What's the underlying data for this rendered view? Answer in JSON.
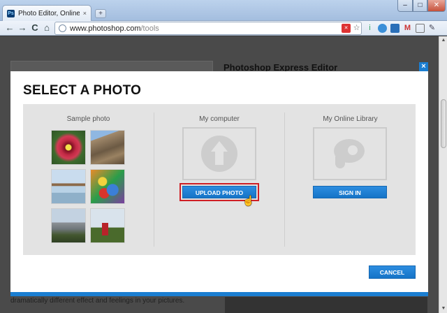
{
  "browser": {
    "tab_title": "Photo Editor, Online Ph...",
    "tab_close": "×",
    "new_tab": "+",
    "url_host": "www.photoshop.com",
    "url_path": "/tools",
    "nav": {
      "back": "←",
      "forward": "→",
      "reload": "C",
      "home": "⌂"
    },
    "window": {
      "minimize": "–",
      "maximize": "□",
      "close": "✕"
    }
  },
  "background_page": {
    "heading": "Photoshop Express Editor",
    "caption": "dramatically different effect and feelings in your pictures."
  },
  "modal": {
    "title": "SELECT A PHOTO",
    "close": "×",
    "columns": {
      "sample": {
        "label": "Sample photo"
      },
      "computer": {
        "label": "My computer",
        "button": "UPLOAD PHOTO"
      },
      "library": {
        "label": "My Online Library",
        "button": "SIGN IN"
      }
    },
    "cancel": "CANCEL"
  },
  "colors": {
    "accent": "#1b7ed1",
    "highlight": "#cf1f25",
    "panel": "#e3e3e3"
  }
}
